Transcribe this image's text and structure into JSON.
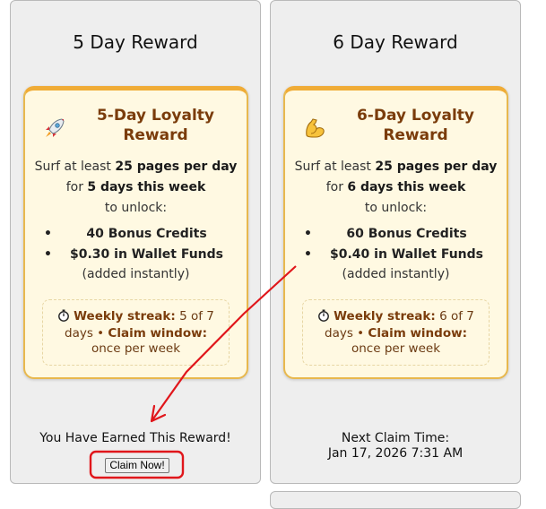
{
  "cards": [
    {
      "column_title": "5 Day Reward",
      "emoji": "rocket-icon",
      "card_title": "5-Day Loyalty Reward",
      "desc_prefix": "Surf at least ",
      "desc_pages": "25 pages per day",
      "desc_for": " for ",
      "desc_days": "5 days this week",
      "desc_suffix": "to unlock:",
      "items": [
        "40 Bonus Credits",
        "$0.30 in Wallet Funds"
      ],
      "added_note": "(added instantly)",
      "streak_label": "Weekly streak:",
      "streak_value": "5 of 7 days",
      "window_label": "Claim window:",
      "window_value": "once per week",
      "footer_text": "You Have Earned This Reward!",
      "button_label": "Claim Now!"
    },
    {
      "column_title": "6 Day Reward",
      "emoji": "flexed-arm-icon",
      "card_title": "6-Day Loyalty Reward",
      "desc_prefix": "Surf at least ",
      "desc_pages": "25 pages per day",
      "desc_for": " for ",
      "desc_days": "6 days this week",
      "desc_suffix": "to unlock:",
      "items": [
        "60 Bonus Credits",
        "$0.40 in Wallet Funds"
      ],
      "added_note": "(added instantly)",
      "streak_label": "Weekly streak:",
      "streak_value": "6 of 7 days",
      "window_label": "Claim window:",
      "window_value": "once per week",
      "next_label": "Next Claim Time:",
      "next_time": "Jan 17, 2026 7:31 AM"
    }
  ],
  "annotation_color": "#e0161b",
  "accent_color": "#f0ac36",
  "title_color": "#7a3c0b"
}
